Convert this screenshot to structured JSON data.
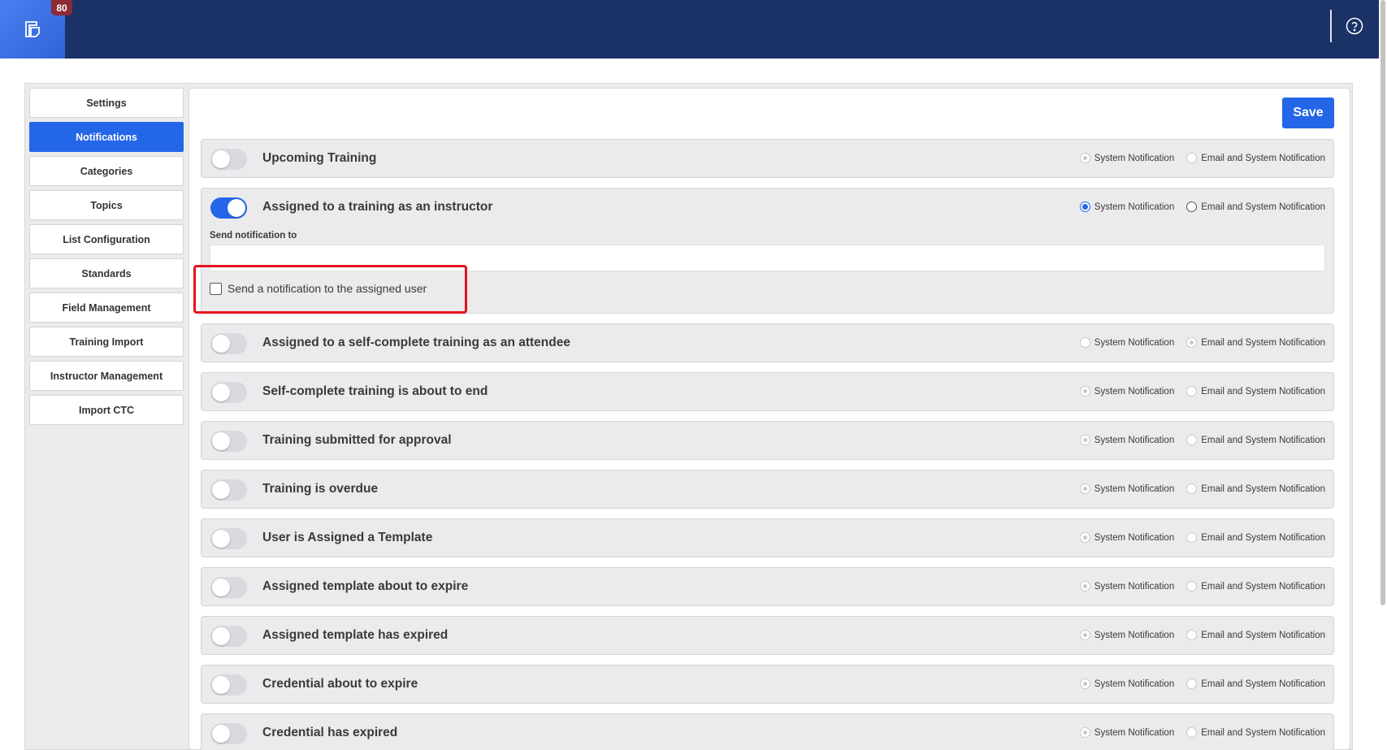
{
  "header": {
    "badge": "80",
    "logo_icon": "app-logo-icon",
    "help_icon": "help-circle-icon"
  },
  "sidebar": {
    "items": [
      {
        "label": "Settings",
        "active": false
      },
      {
        "label": "Notifications",
        "active": true
      },
      {
        "label": "Categories",
        "active": false
      },
      {
        "label": "Topics",
        "active": false
      },
      {
        "label": "List Configuration",
        "active": false
      },
      {
        "label": "Standards",
        "active": false
      },
      {
        "label": "Field Management",
        "active": false
      },
      {
        "label": "Training Import",
        "active": false
      },
      {
        "label": "Instructor Management",
        "active": false
      },
      {
        "label": "Import CTC",
        "active": false
      }
    ]
  },
  "toolbar": {
    "save_label": "Save"
  },
  "radio_labels": {
    "system": "System Notification",
    "email": "Email and System Notification"
  },
  "notifications": [
    {
      "title": "Upcoming Training",
      "enabled": false,
      "selected": "system"
    },
    {
      "title": "Assigned to a training as an instructor",
      "enabled": true,
      "selected": "system"
    },
    {
      "title": "Assigned to a self-complete training as an attendee",
      "enabled": false,
      "selected": "email"
    },
    {
      "title": "Self-complete training is about to end",
      "enabled": false,
      "selected": "system"
    },
    {
      "title": "Training submitted for approval",
      "enabled": false,
      "selected": "system"
    },
    {
      "title": "Training is overdue",
      "enabled": false,
      "selected": "system"
    },
    {
      "title": "User is Assigned a Template",
      "enabled": false,
      "selected": "system"
    },
    {
      "title": "Assigned template about to expire",
      "enabled": false,
      "selected": "system"
    },
    {
      "title": "Assigned template has expired",
      "enabled": false,
      "selected": "system"
    },
    {
      "title": "Credential about to expire",
      "enabled": false,
      "selected": "system"
    },
    {
      "title": "Credential has expired",
      "enabled": false,
      "selected": "system"
    }
  ],
  "expanded": {
    "send_to_label": "Send notification to",
    "send_to_value": "",
    "send_to_placeholder": "",
    "assigned_user_checkbox_label": "Send a notification to the assigned user",
    "assigned_user_checked": false
  },
  "colors": {
    "header": "#1b3266",
    "accent": "#2466e8",
    "badge": "#8c2a36",
    "highlight": "#e3141e"
  }
}
